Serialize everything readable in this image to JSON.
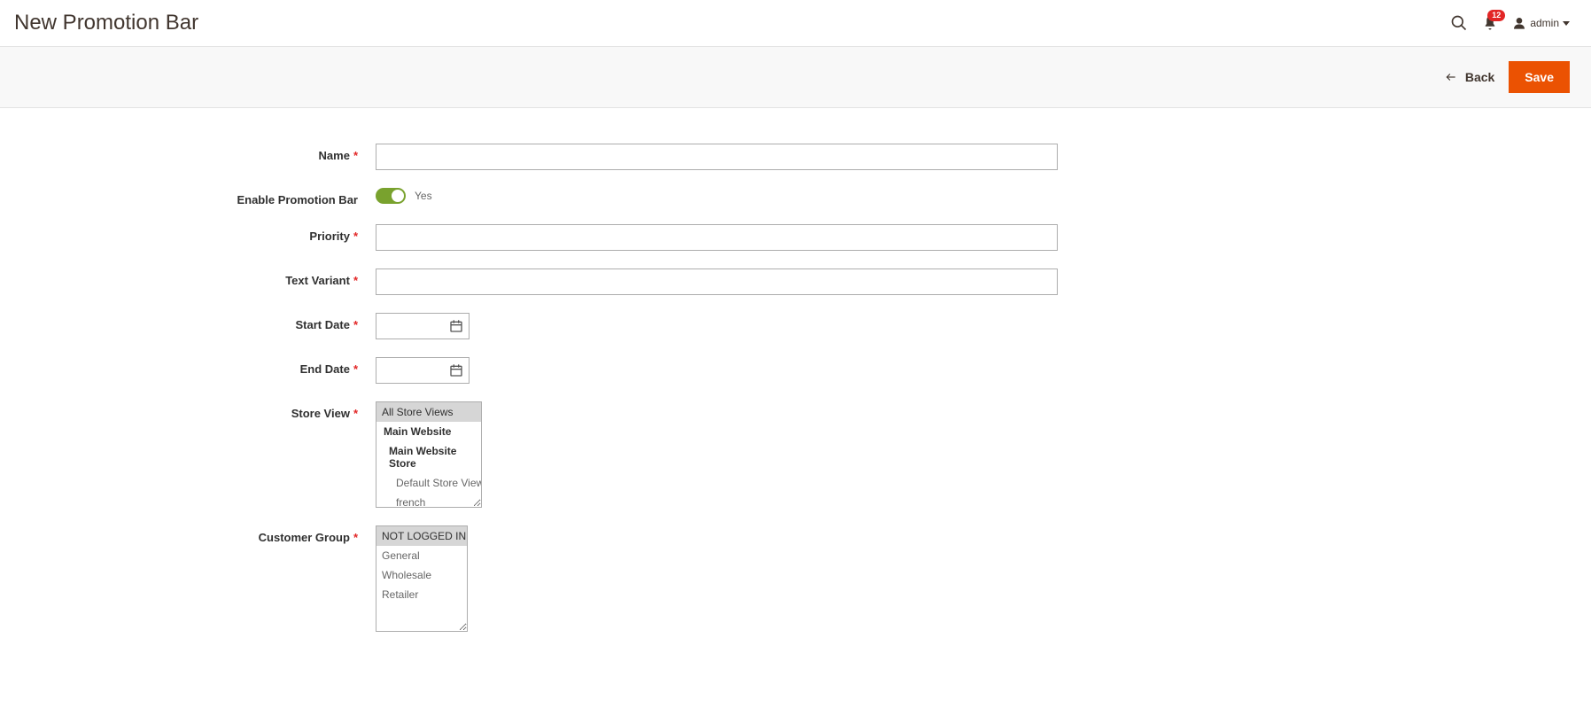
{
  "header": {
    "title": "New Promotion Bar",
    "notification_count": "12",
    "user_label": "admin"
  },
  "actions": {
    "back_label": "Back",
    "save_label": "Save"
  },
  "form": {
    "name": {
      "label": "Name",
      "value": ""
    },
    "enable": {
      "label": "Enable Promotion Bar",
      "value_label": "Yes"
    },
    "priority": {
      "label": "Priority",
      "value": ""
    },
    "text_variant": {
      "label": "Text Variant",
      "value": ""
    },
    "start_date": {
      "label": "Start Date",
      "value": ""
    },
    "end_date": {
      "label": "End Date",
      "value": ""
    },
    "store_view": {
      "label": "Store View",
      "all": "All Store Views",
      "website": "Main Website",
      "store": "Main Website Store",
      "views": [
        "Default Store View",
        "french"
      ]
    },
    "customer_group": {
      "label": "Customer Group",
      "options": [
        "NOT LOGGED IN",
        "General",
        "Wholesale",
        "Retailer"
      ]
    }
  }
}
